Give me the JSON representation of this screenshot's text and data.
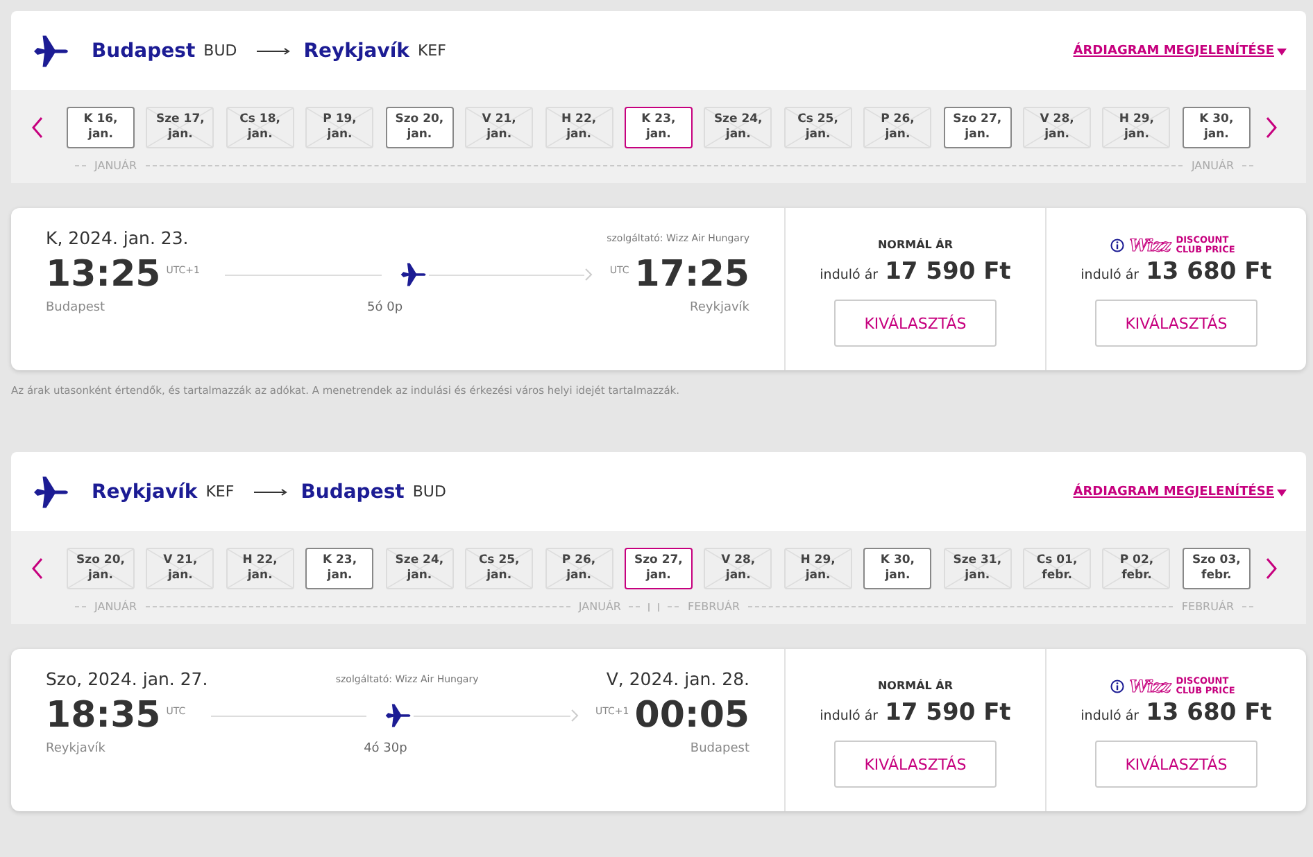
{
  "sections": [
    {
      "route": {
        "from_city": "Budapest",
        "from_code": "BUD",
        "to_city": "Reykjavík",
        "to_code": "KEF"
      },
      "chart_link": "ÁRDIAGRAM MEGJELENÍTÉSE",
      "dates": [
        {
          "day": "K 16,",
          "month": "jan.",
          "available": true,
          "selected": false
        },
        {
          "day": "Sze 17,",
          "month": "jan.",
          "available": false,
          "selected": false
        },
        {
          "day": "Cs 18,",
          "month": "jan.",
          "available": false,
          "selected": false
        },
        {
          "day": "P 19,",
          "month": "jan.",
          "available": false,
          "selected": false
        },
        {
          "day": "Szo 20,",
          "month": "jan.",
          "available": true,
          "selected": false
        },
        {
          "day": "V 21,",
          "month": "jan.",
          "available": false,
          "selected": false
        },
        {
          "day": "H 22,",
          "month": "jan.",
          "available": false,
          "selected": false
        },
        {
          "day": "K 23,",
          "month": "jan.",
          "available": true,
          "selected": true
        },
        {
          "day": "Sze 24,",
          "month": "jan.",
          "available": false,
          "selected": false
        },
        {
          "day": "Cs 25,",
          "month": "jan.",
          "available": false,
          "selected": false
        },
        {
          "day": "P 26,",
          "month": "jan.",
          "available": false,
          "selected": false
        },
        {
          "day": "Szo 27,",
          "month": "jan.",
          "available": true,
          "selected": false
        },
        {
          "day": "V 28,",
          "month": "jan.",
          "available": false,
          "selected": false
        },
        {
          "day": "H 29,",
          "month": "jan.",
          "available": false,
          "selected": false
        },
        {
          "day": "K 30,",
          "month": "jan.",
          "available": true,
          "selected": false
        }
      ],
      "months": [
        {
          "label": "JANUÁR",
          "kind": "start"
        },
        {
          "label": "JANUÁR",
          "kind": "end"
        }
      ],
      "flight": {
        "dep_date": "K, 2024. jan. 23.",
        "operator": "szolgáltató: Wizz Air Hungary",
        "dep_time": "13:25",
        "dep_tz": "UTC+1",
        "arr_tz": "UTC",
        "arr_time": "17:25",
        "dep_city": "Budapest",
        "duration": "5ó 0p",
        "arr_city": "Reykjavík"
      },
      "fares": [
        {
          "kind": "normal",
          "title": "NORMÁL ÁR",
          "prefix": "induló ár",
          "price": "17 590 Ft",
          "button": "KIVÁLASZTÁS"
        },
        {
          "kind": "club",
          "logo": "Wizz",
          "title": "DISCOUNT CLUB PRICE",
          "prefix": "induló ár",
          "price": "13 680 Ft",
          "button": "KIVÁLASZTÁS"
        }
      ],
      "note": "Az árak utasonként értendők, és tartalmazzák az adókat. A menetrendek az indulási és érkezési város helyi idejét tartalmazzák."
    },
    {
      "route": {
        "from_city": "Reykjavík",
        "from_code": "KEF",
        "to_city": "Budapest",
        "to_code": "BUD"
      },
      "chart_link": "ÁRDIAGRAM MEGJELENÍTÉSE",
      "dates": [
        {
          "day": "Szo 20,",
          "month": "jan.",
          "available": false,
          "selected": false
        },
        {
          "day": "V 21,",
          "month": "jan.",
          "available": false,
          "selected": false
        },
        {
          "day": "H 22,",
          "month": "jan.",
          "available": false,
          "selected": false
        },
        {
          "day": "K 23,",
          "month": "jan.",
          "available": true,
          "selected": false
        },
        {
          "day": "Sze 24,",
          "month": "jan.",
          "available": false,
          "selected": false
        },
        {
          "day": "Cs 25,",
          "month": "jan.",
          "available": false,
          "selected": false
        },
        {
          "day": "P 26,",
          "month": "jan.",
          "available": false,
          "selected": false
        },
        {
          "day": "Szo 27,",
          "month": "jan.",
          "available": true,
          "selected": true
        },
        {
          "day": "V 28,",
          "month": "jan.",
          "available": false,
          "selected": false
        },
        {
          "day": "H 29,",
          "month": "jan.",
          "available": false,
          "selected": false
        },
        {
          "day": "K 30,",
          "month": "jan.",
          "available": true,
          "selected": false
        },
        {
          "day": "Sze 31,",
          "month": "jan.",
          "available": false,
          "selected": false
        },
        {
          "day": "Cs 01,",
          "month": "febr.",
          "available": false,
          "selected": false
        },
        {
          "day": "P 02,",
          "month": "febr.",
          "available": false,
          "selected": false
        },
        {
          "day": "Szo 03,",
          "month": "febr.",
          "available": true,
          "selected": false
        }
      ],
      "months": [
        {
          "label": "JANUÁR",
          "kind": "start"
        },
        {
          "label": "JANUÁR",
          "kind": "end"
        },
        {
          "label": "FEBRUÁR",
          "kind": "start"
        },
        {
          "label": "FEBRUÁR",
          "kind": "end"
        }
      ],
      "flight": {
        "dep_date": "Szo, 2024. jan. 27.",
        "operator": "szolgáltató: Wizz Air Hungary",
        "arr_date": "V, 2024. jan. 28.",
        "dep_time": "18:35",
        "dep_tz": "UTC",
        "arr_tz": "UTC+1",
        "arr_time": "00:05",
        "dep_city": "Reykjavík",
        "duration": "4ó 30p",
        "arr_city": "Budapest"
      },
      "fares": [
        {
          "kind": "normal",
          "title": "NORMÁL ÁR",
          "prefix": "induló ár",
          "price": "17 590 Ft",
          "button": "KIVÁLASZTÁS"
        },
        {
          "kind": "club",
          "logo": "Wizz",
          "title": "DISCOUNT CLUB PRICE",
          "prefix": "induló ár",
          "price": "13 680 Ft",
          "button": "KIVÁLASZTÁS"
        }
      ]
    }
  ]
}
